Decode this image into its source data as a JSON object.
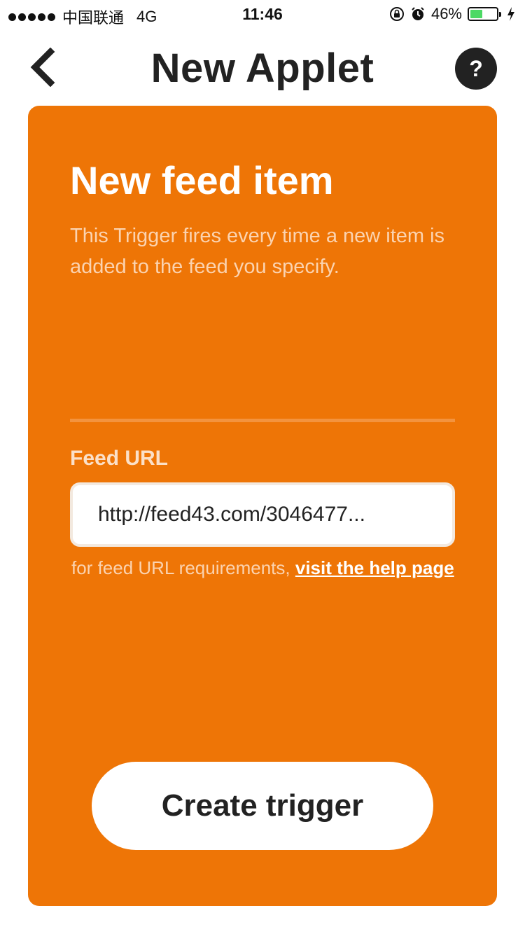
{
  "status_bar": {
    "carrier": "中国联通",
    "network": "4G",
    "time": "11:46",
    "battery_percent": "46%",
    "battery_level": 0.46,
    "battery_color": "#4cd964",
    "icons": [
      "signal-dots-icon",
      "rotation-lock-icon",
      "alarm-icon",
      "battery-icon",
      "charging-bolt-icon"
    ]
  },
  "header": {
    "title": "New Applet",
    "back_icon": "chevron-left-icon",
    "help_label": "?"
  },
  "trigger": {
    "title": "New feed item",
    "description": "This Trigger fires every time a new item is added to the feed you specify.",
    "field_label": "Feed URL",
    "field_value": "http://feed43.com/3046477...",
    "helper_prefix": "for feed URL requirements, ",
    "helper_link": "visit the help page",
    "button_label": "Create trigger"
  },
  "colors": {
    "card_background": "#ee7506",
    "header_text": "#222222",
    "help_button": "#222222"
  }
}
